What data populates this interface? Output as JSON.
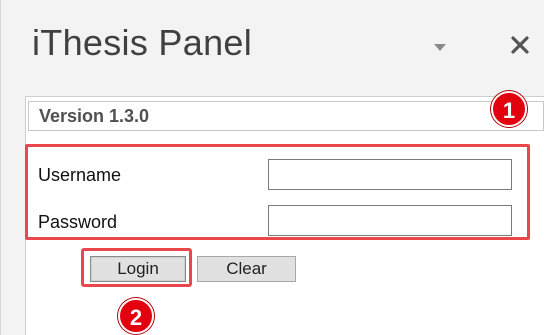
{
  "panel": {
    "title": "iThesis Panel",
    "dropdown_icon": "chevron-down-icon",
    "close_icon": "close-icon"
  },
  "version": {
    "label": "Version 1.3.0"
  },
  "login_form": {
    "username_label": "Username",
    "username_value": "",
    "password_label": "Password",
    "password_value": ""
  },
  "buttons": {
    "login_label": "Login",
    "clear_label": "Clear"
  },
  "annotations": {
    "badge_1": "1",
    "badge_2": "2",
    "highlight_color": "#e8474b",
    "badge_color": "#e3000f"
  }
}
